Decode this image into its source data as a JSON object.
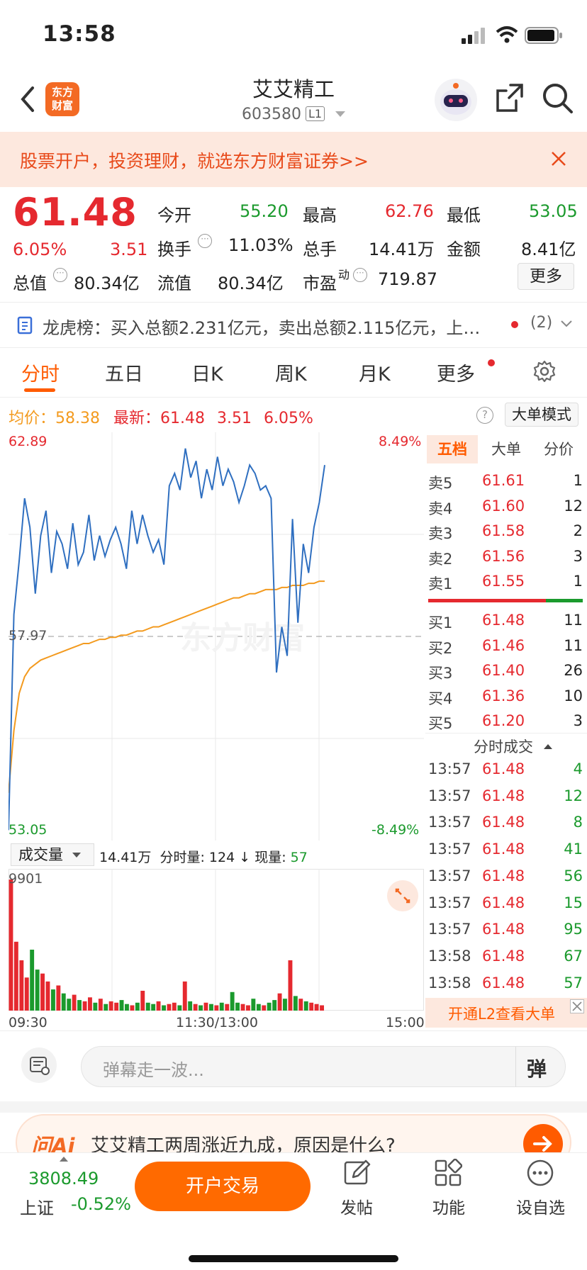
{
  "status_bar": {
    "time": "13:58"
  },
  "header": {
    "title": "艾艾精工",
    "code": "603580",
    "level": "L1",
    "logo_line1": "东方",
    "logo_line2": "财富"
  },
  "banner": {
    "text": "股票开户，投资理财，就选东方财富证券>>"
  },
  "quote": {
    "price": "61.48",
    "change_pct": "6.05%",
    "change": "3.51",
    "open_label": "今开",
    "open": "55.20",
    "high_label": "最高",
    "high": "62.76",
    "low_label": "最低",
    "low": "53.05",
    "turnover_label": "换手",
    "turnover": "11.03%",
    "volume_label": "总手",
    "volume": "14.41万",
    "amount_label": "金额",
    "amount": "8.41亿",
    "mktcap_label": "总值",
    "mktcap": "80.34亿",
    "float_label": "流值",
    "float": "80.34亿",
    "pe_label": "市盈",
    "pe_sup": "动",
    "pe": "719.87",
    "more_label": "更多"
  },
  "dragon": {
    "text": "龙虎榜：买入总额2.231亿元，卖出总额2.115亿元，上…",
    "count": "(2)"
  },
  "tabs": [
    "分时",
    "五日",
    "日K",
    "周K",
    "月K",
    "更多"
  ],
  "info_line": {
    "avg_label": "均价：",
    "avg": "58.38",
    "latest_label": "最新：",
    "latest": "61.48",
    "change": "3.51",
    "pct": "6.05%",
    "mode_button": "大单模式"
  },
  "chart_data": {
    "type": "line",
    "y_top": "62.89",
    "y_mid": "57.97",
    "y_bottom": "53.05",
    "pct_top": "8.49%",
    "pct_bottom": "-8.49%",
    "x_ticks": [
      "09:30",
      "11:30/13:00",
      "15:00"
    ],
    "ylim": [
      53.05,
      62.89
    ],
    "price": [
      53.3,
      58.5,
      59.8,
      61.3,
      60.6,
      59.0,
      60.4,
      61.0,
      59.5,
      60.5,
      60.2,
      59.6,
      60.7,
      59.7,
      60.0,
      60.9,
      59.8,
      60.4,
      59.9,
      60.3,
      60.6,
      60.2,
      59.6,
      61.0,
      60.2,
      60.9,
      60.4,
      60.0,
      60.3,
      59.7,
      61.6,
      61.9,
      61.5,
      62.5,
      61.8,
      62.2,
      61.3,
      62.0,
      61.5,
      62.3,
      61.6,
      62.0,
      61.7,
      61.2,
      61.6,
      62.1,
      61.9,
      61.5,
      61.6,
      61.3,
      57.1,
      58.2,
      57.5,
      60.8,
      58.3,
      60.2,
      59.5,
      60.6,
      61.2,
      62.1
    ],
    "avg": [
      54.2,
      55.7,
      56.6,
      57.0,
      57.2,
      57.3,
      57.4,
      57.45,
      57.5,
      57.55,
      57.6,
      57.65,
      57.7,
      57.75,
      57.8,
      57.8,
      57.85,
      57.9,
      57.9,
      57.95,
      57.95,
      58.0,
      58.0,
      58.05,
      58.1,
      58.1,
      58.15,
      58.2,
      58.2,
      58.25,
      58.3,
      58.35,
      58.4,
      58.45,
      58.5,
      58.55,
      58.6,
      58.65,
      58.7,
      58.75,
      58.8,
      58.85,
      58.9,
      58.9,
      58.95,
      59.0,
      59.0,
      59.05,
      59.1,
      59.1,
      59.1,
      59.15,
      59.15,
      59.2,
      59.2,
      59.2,
      59.25,
      59.25,
      59.3,
      59.3
    ],
    "volume_label": "成交量",
    "volume_total": "14.41万",
    "minute_vol_label": "分时量:",
    "minute_vol": "124",
    "cur_vol_label": "现量:",
    "cur_vol": "57",
    "vol_max": "9901",
    "volumes": [
      9901,
      5200,
      3800,
      2500,
      4600,
      3100,
      2800,
      2200,
      1600,
      1900,
      1300,
      900,
      1200,
      800,
      700,
      1000,
      600,
      900,
      500,
      700,
      600,
      800,
      500,
      400,
      600,
      1500,
      600,
      500,
      700,
      400,
      500,
      600,
      400,
      2200,
      700,
      500,
      400,
      600,
      500,
      400,
      600,
      500,
      1400,
      600,
      500,
      400,
      900,
      500,
      400,
      600,
      800,
      1300,
      900,
      3800,
      1100,
      900,
      700,
      600,
      500,
      400
    ]
  },
  "order_book": {
    "tabs": [
      "五档",
      "大单",
      "分价"
    ],
    "asks": [
      {
        "label": "卖5",
        "price": "61.61",
        "qty": "1"
      },
      {
        "label": "卖4",
        "price": "61.60",
        "qty": "12"
      },
      {
        "label": "卖3",
        "price": "61.58",
        "qty": "2"
      },
      {
        "label": "卖2",
        "price": "61.56",
        "qty": "3"
      },
      {
        "label": "卖1",
        "price": "61.55",
        "qty": "1"
      }
    ],
    "bids": [
      {
        "label": "买1",
        "price": "61.48",
        "qty": "11"
      },
      {
        "label": "买2",
        "price": "61.46",
        "qty": "11"
      },
      {
        "label": "买3",
        "price": "61.40",
        "qty": "26"
      },
      {
        "label": "买4",
        "price": "61.36",
        "qty": "10"
      },
      {
        "label": "买5",
        "price": "61.20",
        "qty": "3"
      }
    ],
    "ticks_title": "分时成交",
    "ticks": [
      {
        "t": "13:57",
        "p": "61.48",
        "v": "4"
      },
      {
        "t": "13:57",
        "p": "61.48",
        "v": "12"
      },
      {
        "t": "13:57",
        "p": "61.48",
        "v": "8"
      },
      {
        "t": "13:57",
        "p": "61.48",
        "v": "41"
      },
      {
        "t": "13:57",
        "p": "61.48",
        "v": "56"
      },
      {
        "t": "13:57",
        "p": "61.48",
        "v": "15"
      },
      {
        "t": "13:57",
        "p": "61.48",
        "v": "95"
      },
      {
        "t": "13:58",
        "p": "61.48",
        "v": "67"
      },
      {
        "t": "13:58",
        "p": "61.48",
        "v": "57"
      }
    ],
    "l2_text": "开通L2查看大单"
  },
  "comment": {
    "placeholder": "弹幕走一波...",
    "danmu_label": "弹"
  },
  "ai": {
    "logo": "问Ai",
    "text": "艾艾精工两周涨近九成，原因是什么?"
  },
  "bottom_bar": {
    "index_value": "3808.49",
    "index_name": "上证",
    "index_pct": "-0.52%",
    "trade_button": "开户交易",
    "post_label": "发帖",
    "func_label": "功能",
    "watch_label": "设自选"
  },
  "colors": {
    "up": "#e5292f",
    "down": "#1b9a2d",
    "accent": "#ff5b00",
    "price_line": "#2f6fc0",
    "avg_line": "#f39a1e"
  }
}
